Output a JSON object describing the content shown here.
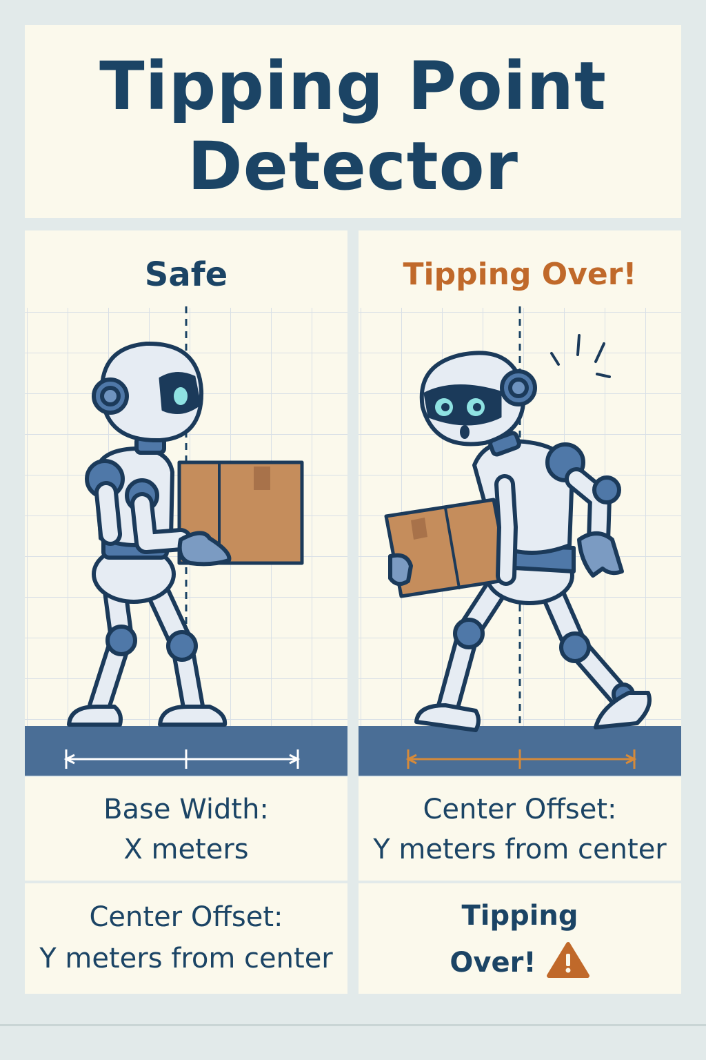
{
  "title": {
    "line1": "Tipping Point",
    "line2": "Detector"
  },
  "left_panel": {
    "heading": "Safe",
    "box_label": "box",
    "colors": {
      "heading": "#1b4465",
      "measure": "#ffffff"
    }
  },
  "right_panel": {
    "heading": "Tipping Over!",
    "colors": {
      "heading": "#c0692a",
      "measure": "#d58a3a"
    }
  },
  "info": {
    "left_top": {
      "line1": "Base Width:",
      "line2": "X meters"
    },
    "right_top": {
      "line1": "Center Offset:",
      "line2": "Y meters from center"
    },
    "left_bottom": {
      "line1": "Center Offset:",
      "line2": "Y meters from center"
    },
    "right_bottom": {
      "line1": "Tipping",
      "line2": "Over!",
      "icon": "warning-icon"
    }
  },
  "colors": {
    "navy": "#1b4465",
    "accent": "#c0692a",
    "floor": "#4a6e96",
    "background": "#e2eaea"
  }
}
